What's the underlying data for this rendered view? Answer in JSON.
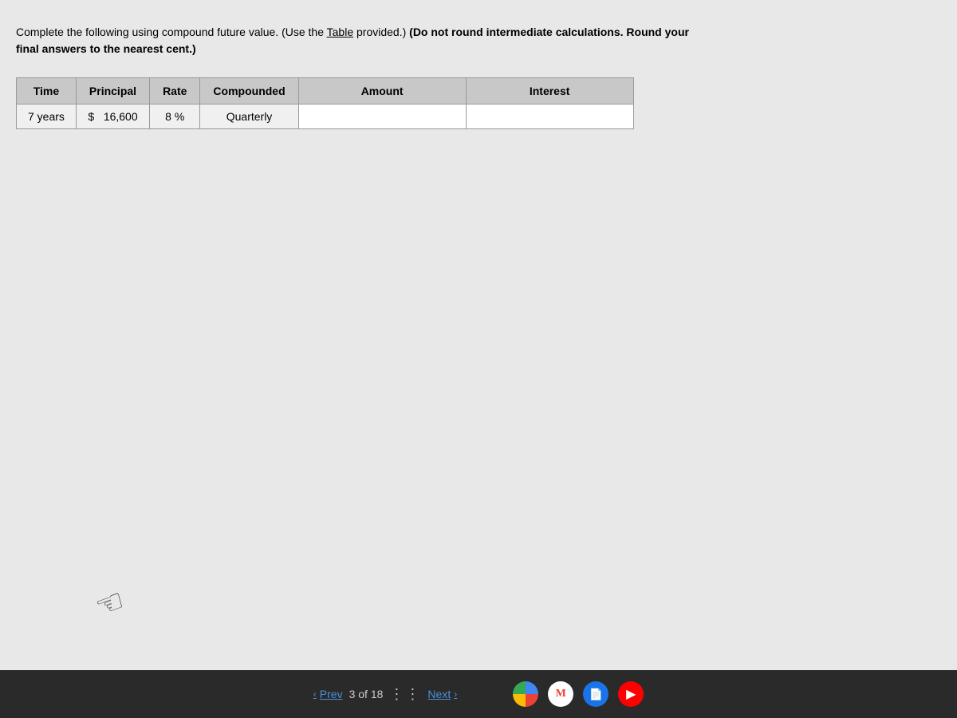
{
  "instructions": {
    "line1": "Complete the following using compound future value. (Use the ",
    "table_link": "Table",
    "line2": " provided.) ",
    "bold_part": "(Do not round intermediate calculations. Round your",
    "line3": "final answers to the nearest cent.)"
  },
  "table": {
    "headers": [
      "Time",
      "Principal",
      "Rate",
      "Compounded",
      "Amount",
      "Interest"
    ],
    "row": {
      "time": "7 years",
      "principal_symbol": "$",
      "principal_value": "16,600",
      "rate": "8",
      "rate_symbol": "%",
      "compounded": "Quarterly",
      "amount": "",
      "interest": ""
    }
  },
  "navigation": {
    "prev_label": "Prev",
    "next_label": "Next",
    "current_page": "3",
    "total_pages": "18",
    "page_separator": "of"
  },
  "taskbar": {
    "icons": {
      "google": "G",
      "gmail": "M",
      "files": "📄",
      "youtube": "▶"
    }
  }
}
